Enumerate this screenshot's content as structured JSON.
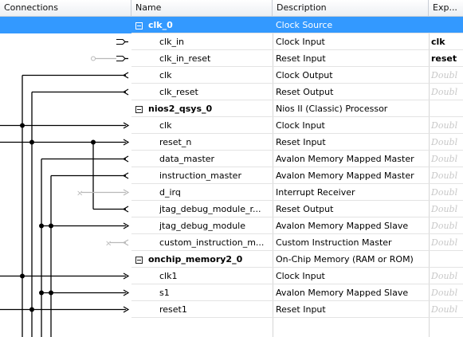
{
  "headers": {
    "connections": "Connections",
    "name": "Name",
    "description": "Description",
    "export": "Exp..."
  },
  "rows": [
    {
      "name": "clk_0",
      "description": "Clock Source",
      "export": "",
      "type": "component",
      "selected": true
    },
    {
      "name": "clk_in",
      "description": "Clock Input",
      "export": "clk",
      "type": "port"
    },
    {
      "name": "clk_in_reset",
      "description": "Reset Input",
      "export": "reset",
      "type": "port"
    },
    {
      "name": "clk",
      "description": "Clock Output",
      "export": "Doubl",
      "type": "port"
    },
    {
      "name": "clk_reset",
      "description": "Reset Output",
      "export": "Doubl",
      "type": "port"
    },
    {
      "name": "nios2_qsys_0",
      "description": "Nios II (Classic) Processor",
      "export": "",
      "type": "component"
    },
    {
      "name": "clk",
      "description": "Clock Input",
      "export": "Doubl",
      "type": "port"
    },
    {
      "name": "reset_n",
      "description": "Reset Input",
      "export": "Doubl",
      "type": "port"
    },
    {
      "name": "data_master",
      "description": "Avalon Memory Mapped Master",
      "export": "Doubl",
      "type": "port"
    },
    {
      "name": "instruction_master",
      "description": "Avalon Memory Mapped Master",
      "export": "Doubl",
      "type": "port"
    },
    {
      "name": "d_irq",
      "description": "Interrupt Receiver",
      "export": "Doubl",
      "type": "port"
    },
    {
      "name": "jtag_debug_module_r...",
      "description": "Reset Output",
      "export": "Doubl",
      "type": "port"
    },
    {
      "name": "jtag_debug_module",
      "description": "Avalon Memory Mapped Slave",
      "export": "Doubl",
      "type": "port"
    },
    {
      "name": "custom_instruction_m...",
      "description": "Custom Instruction Master",
      "export": "Doubl",
      "type": "port"
    },
    {
      "name": "onchip_memory2_0",
      "description": "On-Chip Memory (RAM or ROM)",
      "export": "",
      "type": "component"
    },
    {
      "name": "clk1",
      "description": "Clock Input",
      "export": "Doubl",
      "type": "port"
    },
    {
      "name": "s1",
      "description": "Avalon Memory Mapped Slave",
      "export": "Doubl",
      "type": "port"
    },
    {
      "name": "reset1",
      "description": "Reset Input",
      "export": "Doubl",
      "type": "port"
    }
  ],
  "colors": {
    "selection": "#3399ff",
    "wire": "#000000",
    "inactive_wire": "#b8b8b8",
    "export_hint": "#c8c8c8"
  }
}
